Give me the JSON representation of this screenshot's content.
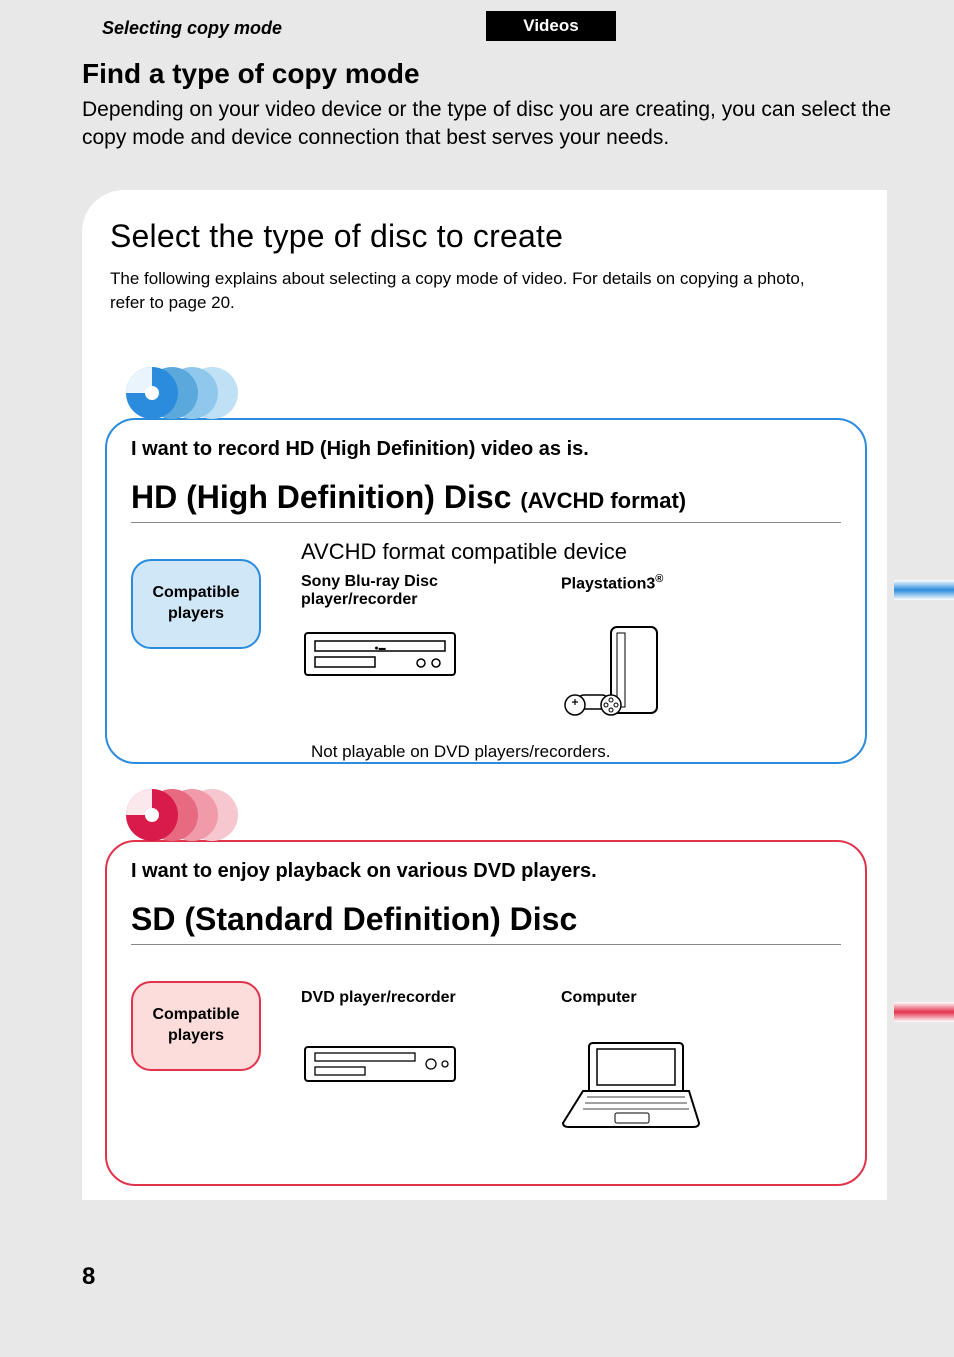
{
  "header": {
    "breadcrumb": "Selecting copy mode",
    "tab": "Videos"
  },
  "intro": {
    "title": "Find a type of copy mode",
    "body": "Depending on your video device or the type of disc you are creating, you can select the copy mode and device connection that best serves your needs."
  },
  "panel": {
    "title": "Select the type of disc to create",
    "note": "The following explains about selecting a copy mode of video. For details on copying a photo, refer to page 20."
  },
  "hd": {
    "want": "I want to record HD (High Definition) video as is.",
    "title_main": "HD (High Definition) Disc ",
    "title_sub": "(AVCHD format)",
    "badge": "Compatible players",
    "devices_heading": "AVCHD format compatible device",
    "device1": "Sony Blu-ray Disc player/recorder",
    "device2_base": "Playstation3",
    "device2_sup": "®",
    "footnote": "Not playable on DVD players/recorders."
  },
  "sd": {
    "want": "I want to enjoy playback on various DVD players.",
    "title_main": "SD (Standard Definition) Disc",
    "badge": "Compatible players",
    "device1": "DVD player/recorder",
    "device2": "Computer"
  },
  "page_number": "8",
  "colors": {
    "blue": "#2b8cdd",
    "red": "#e2334d"
  }
}
